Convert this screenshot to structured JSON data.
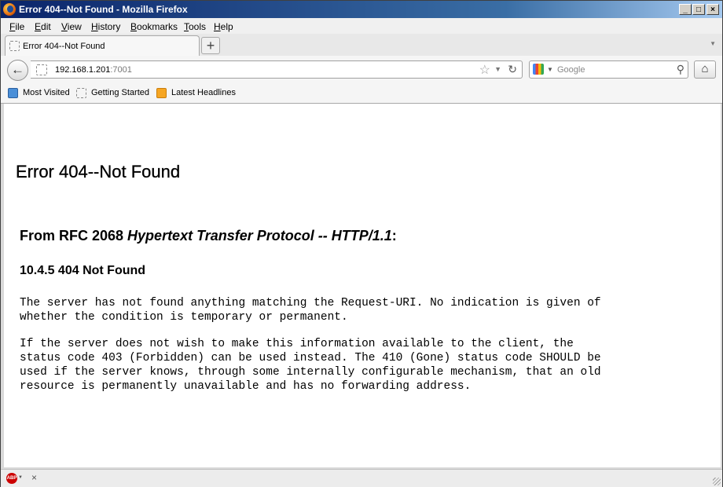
{
  "window": {
    "title": "Error 404--Not Found - Mozilla Firefox",
    "minimize": "_",
    "maximize": "□",
    "close": "×"
  },
  "menu": {
    "items": [
      {
        "underline": "F",
        "rest": "ile"
      },
      {
        "underline": "E",
        "rest": "dit"
      },
      {
        "underline": "V",
        "rest": "iew"
      },
      {
        "underline": "H",
        "rest": "istory",
        "prefix": ""
      },
      {
        "underline": "B",
        "rest": "ookmarks"
      },
      {
        "underline": "T",
        "rest": "ools"
      },
      {
        "underline": "H",
        "rest": "elp"
      }
    ]
  },
  "tabs": {
    "active_label": "Error 404--Not Found",
    "new_tab": "+"
  },
  "nav": {
    "url_host": "192.168.1.201",
    "url_port": ":7001",
    "search_placeholder": "Google",
    "back": "←",
    "home": "⌂"
  },
  "bookmarks": {
    "items": [
      "Most Visited",
      "Getting Started",
      "Latest Headlines"
    ]
  },
  "page": {
    "title": "Error 404--Not Found",
    "source_prefix": "From RFC 2068 ",
    "source_title": "Hypertext Transfer Protocol -- HTTP/1.1",
    "source_suffix": ":",
    "section": "10.4.5 404 Not Found",
    "para1": "The server has not found anything matching the Request-URI. No indication is given of\nwhether the condition is temporary or permanent.",
    "para2": "If the server does not wish to make this information available to the client, the\nstatus code 403 (Forbidden) can be used instead. The 410 (Gone) status code SHOULD be\nused if the server knows, through some internally configurable mechanism, that an old\nresource is permanently unavailable and has no forwarding address."
  },
  "statusbar": {
    "abp_label": "ABP",
    "close": "×"
  }
}
